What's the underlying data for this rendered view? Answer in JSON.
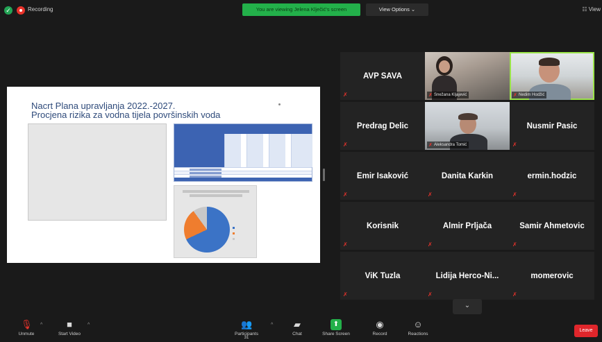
{
  "window": {
    "recording_label": "Recording",
    "share_banner": "You are viewing Jelena Klječić's screen",
    "view_options": "View Options ⌄",
    "view_right": "☷ View"
  },
  "slide": {
    "title": "Nacrt Plana upravljanja 2022.-2027.",
    "subtitle": "Procjena rizika za vodna tijela površinskih voda",
    "pie_colors": {
      "a": "#3b73c6",
      "b": "#ef7d2e",
      "c": "#c8c8c8"
    }
  },
  "gallery": {
    "tiles": [
      {
        "name": "AVP SAVA"
      },
      {
        "label": "Snežana Kljajević"
      },
      {
        "label": "Nedim Hodžić"
      },
      {
        "name": "Predrag Delic"
      },
      {
        "label": "Aleksandra Tomić"
      },
      {
        "name": "Nusmir Pasic"
      },
      {
        "name": "Emir Isaković"
      },
      {
        "name": "Danita Karkin"
      },
      {
        "name": "ermin.hodzic"
      },
      {
        "name": "Korisnik"
      },
      {
        "name": "Almir Prljača"
      },
      {
        "name": "Samir Ahmetovic"
      },
      {
        "name": "ViK Tuzla"
      },
      {
        "name": "Lidija Herco-Ni..."
      },
      {
        "name": "momerovic"
      }
    ],
    "more_icon": "chevron-down-icon"
  },
  "toolbar": {
    "unmute": "Unmute",
    "start_video": "Start Video",
    "participants": "Participants",
    "participants_count": "31",
    "chat": "Chat",
    "share_screen": "Share Screen",
    "record": "Record",
    "reactions": "Reactions",
    "leave": "Leave"
  }
}
